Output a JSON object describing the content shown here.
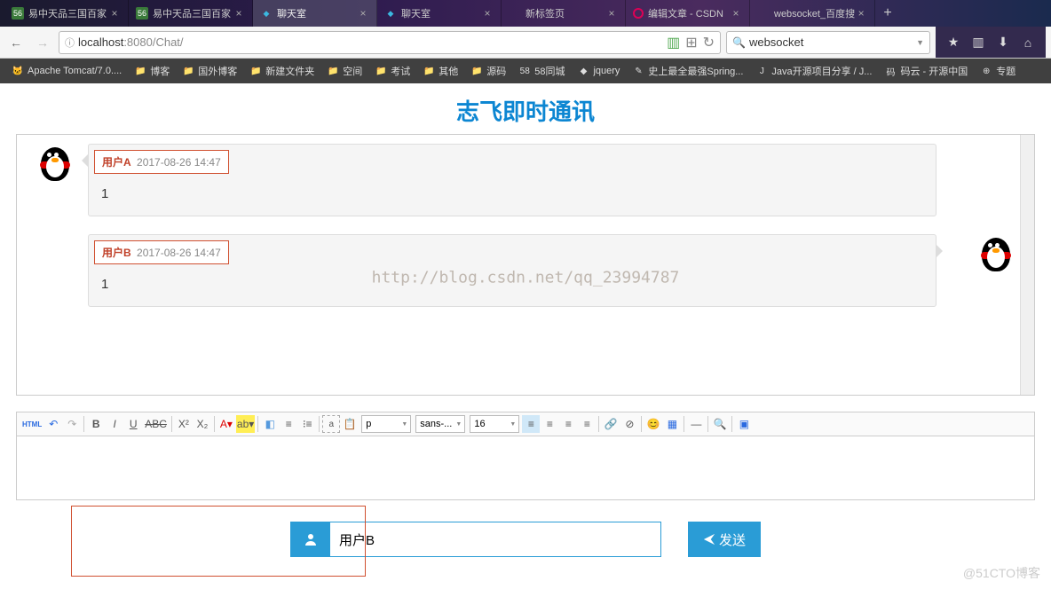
{
  "tabs": [
    {
      "icon": "56",
      "iconClass": "bg-56",
      "title": "易中天品三国百家",
      "active": false
    },
    {
      "icon": "56",
      "iconClass": "bg-56",
      "title": "易中天品三国百家",
      "active": false
    },
    {
      "icon": "◆",
      "iconClass": "bg-blue",
      "title": "聊天室",
      "active": true
    },
    {
      "icon": "◆",
      "iconClass": "bg-blue",
      "title": "聊天室",
      "active": false
    },
    {
      "icon": "",
      "iconClass": "",
      "title": "新标签页",
      "active": false
    },
    {
      "icon": "",
      "iconClass": "bg-csdn",
      "title": "编辑文章 - CSDN",
      "active": false
    },
    {
      "icon": "",
      "iconClass": "bg-baidu",
      "title": "websocket_百度搜",
      "active": false
    }
  ],
  "url": {
    "prefix": "ⓘ",
    "host": "localhost",
    "rest": ":8080/Chat/"
  },
  "search": {
    "placeholder": "websocket",
    "value": "websocket"
  },
  "bookmarks": [
    {
      "icon": "🐱",
      "label": "Apache Tomcat/7.0...."
    },
    {
      "icon": "📁",
      "label": "博客"
    },
    {
      "icon": "📁",
      "label": "国外博客"
    },
    {
      "icon": "📁",
      "label": "新建文件夹"
    },
    {
      "icon": "📁",
      "label": "空间"
    },
    {
      "icon": "📁",
      "label": "考试"
    },
    {
      "icon": "📁",
      "label": "其他"
    },
    {
      "icon": "📁",
      "label": "源码"
    },
    {
      "icon": "58",
      "label": "58同城"
    },
    {
      "icon": "◆",
      "label": "jquery"
    },
    {
      "icon": "✎",
      "label": "史上最全最强Spring..."
    },
    {
      "icon": "J",
      "label": "Java开源项目分享 / J..."
    },
    {
      "icon": "码",
      "label": "码云 - 开源中国"
    },
    {
      "icon": "⊕",
      "label": "专题"
    }
  ],
  "page": {
    "title": "志飞即时通讯",
    "watermark": "http://blog.csdn.net/qq_23994787",
    "corner": "@51CTO博客"
  },
  "messages": [
    {
      "side": "left",
      "user": "用户A",
      "time": "2017-08-26 14:47",
      "body": "1"
    },
    {
      "side": "right",
      "user": "用户B",
      "time": "2017-08-26 14:47",
      "body": "1"
    }
  ],
  "editor": {
    "format_p": "p",
    "font": "sans-...",
    "size": "16"
  },
  "input": {
    "user": "用户B",
    "send": "发送"
  }
}
